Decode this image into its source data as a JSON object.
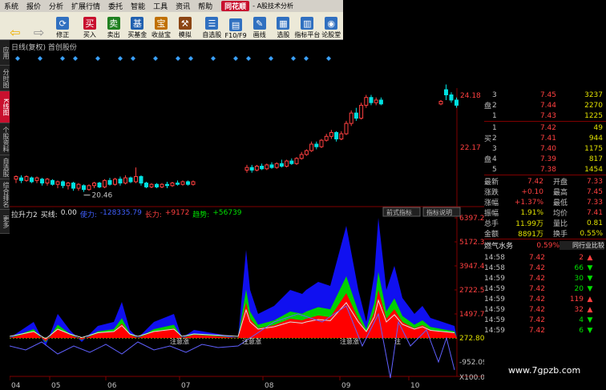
{
  "menu": {
    "items": [
      "系统",
      "报价",
      "分析",
      "扩展行情",
      "委托",
      "智能",
      "工具",
      "资讯",
      "帮助"
    ],
    "logo": "同花顺",
    "subtitle": "- A股技术分析"
  },
  "toolbar": {
    "buttons": [
      {
        "name": "back",
        "label": "",
        "icon": "left-arrow",
        "color": "#f0b000"
      },
      {
        "name": "forward",
        "label": "",
        "icon": "right-arrow",
        "color": "#909090"
      },
      {
        "name": "refresh",
        "label": "修正",
        "icon": "refresh",
        "color": "#3070c0"
      },
      {
        "name": "buy",
        "label": "买入",
        "icon": "买",
        "color": "#c8102e"
      },
      {
        "name": "sell",
        "label": "卖出",
        "icon": "卖",
        "color": "#208020"
      },
      {
        "name": "fund",
        "label": "买基金",
        "icon": "基",
        "color": "#2060b0"
      },
      {
        "name": "treasure",
        "label": "收益宝",
        "icon": "宝",
        "color": "#c07000"
      },
      {
        "name": "simulate",
        "label": "模拟",
        "icon": "hammer",
        "color": "#8b4513"
      },
      {
        "name": "self-select",
        "label": "自选股",
        "icon": "self",
        "color": "#3070c0"
      },
      {
        "name": "f10",
        "label": "F10/F9",
        "icon": "F10",
        "color": "#3070c0"
      },
      {
        "name": "draw",
        "label": "画线",
        "icon": "pen",
        "color": "#3070c0"
      },
      {
        "name": "stock-pick",
        "label": "选股",
        "icon": "filter",
        "color": "#3070c0"
      },
      {
        "name": "indicator",
        "label": "指标平台",
        "icon": "chart",
        "color": "#3070c0"
      },
      {
        "name": "forum",
        "label": "论股堂",
        "icon": "forum",
        "color": "#3070c0"
      }
    ]
  },
  "left_tabs": [
    {
      "label": "应用",
      "active": false
    },
    {
      "label": "分时图",
      "active": false
    },
    {
      "label": "K线图",
      "active": true
    },
    {
      "label": "个股资料",
      "active": false
    },
    {
      "label": "自选股",
      "active": false
    },
    {
      "label": "综合排名",
      "active": false
    },
    {
      "label": "更多",
      "active": false
    }
  ],
  "chart": {
    "title": "日线(复权) 首创股份",
    "price_axis": [
      "24.18",
      "22.17"
    ],
    "low_label": "20.46",
    "indicator": {
      "name": "拉升力2",
      "buy_line_label": "买线:",
      "buy_line_value": "0.00",
      "power_label": "使力:",
      "power_value": "-128335.79",
      "grow_label": "长力:",
      "grow_value": "+9172",
      "trend_label": "趋势:",
      "trend_value": "+56739"
    },
    "tabs": [
      "前式指标",
      "指标说明"
    ],
    "ind_axis": [
      "6397.28",
      "5172.38",
      "3947.49",
      "2722.59",
      "1497.70",
      "272.80",
      "-952.09",
      "X100.00"
    ],
    "date_labels": [
      "04",
      "05",
      "06",
      "07",
      "08",
      "09",
      "10"
    ],
    "annotations": [
      "注意涨",
      "注意涨",
      "注意涨",
      "注"
    ]
  },
  "chart_data": {
    "type": "candlestick",
    "title": "日线(复权) 首创股份",
    "x_months": [
      "04",
      "05",
      "06",
      "07",
      "08",
      "09",
      "10"
    ],
    "price_ticks": [
      24.18,
      22.17
    ],
    "price_low_marker": 20.46,
    "indicator_ticks": [
      6397.28,
      5172.38,
      3947.49,
      2722.59,
      1497.7,
      272.8,
      -952.09
    ],
    "candles": [
      [
        20.95,
        21.05,
        20.8,
        21.1
      ],
      [
        21.0,
        20.9,
        20.8,
        21.1
      ],
      [
        20.9,
        21.05,
        20.85,
        21.1
      ],
      [
        21.0,
        20.85,
        20.8,
        21.05
      ],
      [
        20.9,
        21.0,
        20.8,
        21.05
      ],
      [
        20.95,
        20.8,
        20.7,
        21.0
      ],
      [
        20.8,
        20.95,
        20.7,
        21.0
      ],
      [
        20.9,
        20.75,
        20.7,
        20.95
      ],
      [
        20.75,
        20.85,
        20.6,
        20.9
      ],
      [
        20.85,
        20.7,
        20.6,
        20.9
      ],
      [
        20.7,
        20.8,
        20.55,
        20.85
      ],
      [
        20.8,
        20.6,
        20.5,
        20.85
      ],
      [
        20.6,
        20.75,
        20.5,
        20.8
      ],
      [
        20.7,
        20.55,
        20.46,
        20.75
      ],
      [
        20.55,
        20.7,
        20.5,
        20.75
      ],
      [
        20.7,
        20.8,
        20.6,
        20.85
      ],
      [
        20.8,
        20.65,
        20.6,
        20.85
      ],
      [
        20.65,
        20.9,
        20.6,
        20.95
      ],
      [
        20.9,
        20.75,
        20.7,
        21.0
      ],
      [
        20.75,
        20.95,
        20.7,
        21.0
      ],
      [
        20.95,
        20.8,
        20.7,
        21.05
      ],
      [
        20.8,
        21.0,
        20.75,
        21.1
      ],
      [
        21.0,
        20.85,
        20.8,
        21.05
      ],
      [
        20.85,
        21.05,
        20.8,
        21.4
      ],
      [
        21.05,
        20.8,
        20.7,
        21.1
      ],
      [
        20.8,
        20.65,
        20.6,
        20.85
      ],
      [
        20.65,
        20.75,
        20.6,
        20.8
      ],
      [
        20.75,
        20.65,
        20.6,
        20.8
      ],
      [
        20.65,
        20.75,
        20.6,
        20.8
      ],
      [
        20.75,
        20.7,
        20.6,
        20.85
      ],
      [
        20.7,
        20.8,
        20.65,
        20.85
      ],
      [
        20.8,
        20.75,
        20.7,
        20.9
      ],
      [
        20.75,
        20.85,
        20.7,
        20.9
      ],
      [
        20.85,
        20.75,
        20.7,
        20.9
      ],
      [
        20.75,
        20.85,
        20.7,
        20.9
      ],
      [
        21.3,
        21.4,
        21.2,
        21.5
      ],
      [
        21.4,
        21.3,
        21.2,
        21.5
      ],
      [
        21.3,
        21.45,
        21.25,
        21.5
      ],
      [
        21.45,
        21.35,
        21.3,
        21.55
      ],
      [
        21.35,
        21.5,
        21.3,
        21.55
      ],
      [
        21.5,
        21.4,
        21.35,
        21.6
      ],
      [
        21.4,
        21.55,
        21.35,
        21.6
      ],
      [
        21.55,
        21.45,
        21.4,
        21.7
      ],
      [
        21.45,
        21.65,
        21.4,
        21.7
      ],
      [
        21.65,
        21.55,
        21.5,
        21.75
      ],
      [
        21.55,
        21.75,
        21.5,
        21.8
      ],
      [
        21.75,
        21.9,
        21.7,
        22.0
      ],
      [
        21.9,
        22.05,
        21.85,
        22.1
      ],
      [
        22.05,
        22.3,
        22.0,
        22.4
      ],
      [
        22.3,
        22.2,
        22.1,
        22.4
      ],
      [
        22.2,
        22.45,
        22.15,
        22.5
      ],
      [
        22.45,
        22.6,
        22.4,
        22.7
      ],
      [
        22.6,
        22.75,
        22.5,
        22.85
      ],
      [
        22.75,
        22.5,
        22.4,
        22.8
      ],
      [
        22.5,
        22.7,
        22.45,
        22.8
      ],
      [
        22.7,
        23.1,
        22.65,
        23.2
      ],
      [
        23.1,
        23.5,
        23.0,
        23.6
      ],
      [
        23.5,
        23.3,
        23.2,
        23.7
      ],
      [
        23.3,
        23.8,
        23.25,
        23.9
      ],
      [
        23.8,
        24.1,
        23.7,
        24.2
      ],
      [
        24.1,
        23.9,
        23.8,
        24.2
      ],
      [
        23.9,
        24.0,
        23.8,
        24.1
      ],
      [
        24.0,
        23.85,
        23.8,
        24.1
      ],
      [
        23.85,
        23.95,
        23.8,
        24.0
      ],
      [
        24.4,
        24.2,
        24.0,
        24.6
      ],
      [
        24.2,
        24.0,
        23.9,
        24.3
      ],
      [
        24.0,
        23.8,
        23.7,
        24.1
      ]
    ]
  },
  "order_book": {
    "sell": [
      {
        "level": "3",
        "price": "7.45",
        "volume": "3237"
      },
      {
        "level": "2",
        "price": "7.44",
        "volume": "2270"
      },
      {
        "level": "1",
        "price": "7.43",
        "volume": "1225"
      }
    ],
    "sell_side_label": "盘",
    "buy_side_label_1": "买",
    "buy_side_label_2": "盘",
    "buy": [
      {
        "level": "1",
        "price": "7.42",
        "volume": "49"
      },
      {
        "level": "2",
        "price": "7.41",
        "volume": "944"
      },
      {
        "level": "3",
        "price": "7.40",
        "volume": "1175"
      },
      {
        "level": "4",
        "price": "7.39",
        "volume": "817"
      },
      {
        "level": "5",
        "price": "7.38",
        "volume": "1454"
      }
    ]
  },
  "quote": [
    {
      "k1": "最新",
      "v1": "7.42",
      "c1": "red",
      "k2": "开盘",
      "v2": "7.33",
      "c2": "red"
    },
    {
      "k1": "涨跌",
      "v1": "+0.10",
      "c1": "red",
      "k2": "最高",
      "v2": "7.45",
      "c2": "red"
    },
    {
      "k1": "涨幅",
      "v1": "+1.37%",
      "c1": "red",
      "k2": "最低",
      "v2": "7.33",
      "c2": "red"
    },
    {
      "k1": "振幅",
      "v1": "1.91%",
      "c1": "yellow",
      "k2": "均价",
      "v2": "7.41",
      "c2": "red"
    },
    {
      "k1": "总手",
      "v1": "11.99万",
      "c1": "yellow",
      "k2": "量比",
      "v2": "0.81",
      "c2": "yellow"
    },
    {
      "k1": "金额",
      "v1": "8891万",
      "c1": "yellow",
      "k2": "换手",
      "v2": "0.55%",
      "c2": "yellow"
    }
  ],
  "sector": {
    "name": "燃气水务",
    "change": "0.59%",
    "compare_label": "同行业比较"
  },
  "ticks": [
    {
      "time": "14:58",
      "price": "7.42",
      "volume": "2",
      "vc": "red",
      "dir": "up"
    },
    {
      "time": "14:58",
      "price": "7.42",
      "volume": "66",
      "vc": "green",
      "dir": "down"
    },
    {
      "time": "14:59",
      "price": "7.42",
      "volume": "30",
      "vc": "green",
      "dir": "down"
    },
    {
      "time": "14:59",
      "price": "7.42",
      "volume": "20",
      "vc": "green",
      "dir": "down"
    },
    {
      "time": "14:59",
      "price": "7.42",
      "volume": "119",
      "vc": "red",
      "dir": "up"
    },
    {
      "time": "14:59",
      "price": "7.42",
      "volume": "32",
      "vc": "red",
      "dir": "up"
    },
    {
      "time": "14:59",
      "price": "7.42",
      "volume": "4",
      "vc": "green",
      "dir": "down"
    },
    {
      "time": "14:59",
      "price": "7.42",
      "volume": "6",
      "vc": "green",
      "dir": "down"
    }
  ],
  "watermark": "www.7gpzb.com",
  "colors": {
    "up": "#ff4040",
    "down": "#00e0e0",
    "yellow": "#e0e000",
    "green": "#00e000",
    "blue": "#2020ff"
  }
}
